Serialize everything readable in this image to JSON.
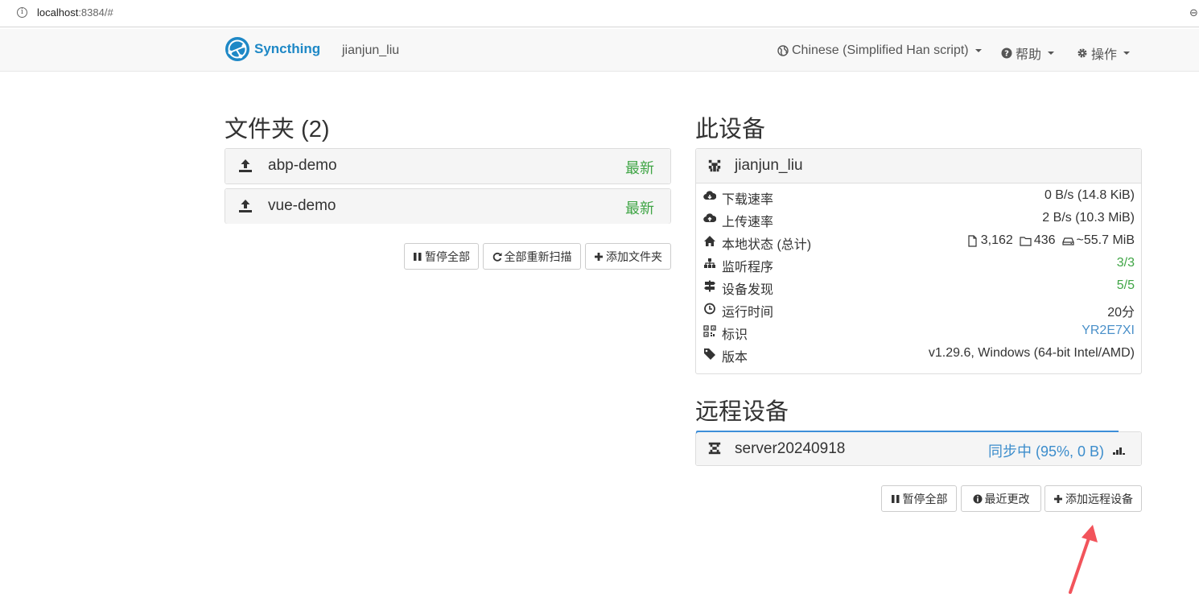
{
  "browser": {
    "url_host": "localhost",
    "url_rest": ":8384/#"
  },
  "navbar": {
    "brand": "Syncthing",
    "device_name": "jianjun_liu",
    "language": "Chinese (Simplified Han script)",
    "help": "帮助",
    "actions": "操作"
  },
  "folders": {
    "heading": "文件夹 (2)",
    "items": [
      {
        "name": "abp-demo",
        "status": "最新"
      },
      {
        "name": "vue-demo",
        "status": "最新"
      }
    ],
    "buttons": {
      "pause_all": "暂停全部",
      "rescan_all": "全部重新扫描",
      "add_folder": "添加文件夹"
    }
  },
  "this_device": {
    "heading": "此设备",
    "name": "jianjun_liu",
    "rows": [
      {
        "label": "下载速率",
        "value": "0 B/s (14.8 KiB)",
        "icon": "cloud-download-icon"
      },
      {
        "label": "上传速率",
        "value": "2 B/s (10.3 MiB)",
        "icon": "cloud-upload-icon"
      },
      {
        "label": "本地状态 (总计)",
        "files": "3,162",
        "dirs": "436",
        "size": "~55.7 MiB",
        "icon": "home-icon"
      },
      {
        "label": "监听程序",
        "value": "3/3",
        "icon": "sitemap-icon"
      },
      {
        "label": "设备发现",
        "value": "5/5",
        "icon": "signpost-icon"
      },
      {
        "label": "运行时间",
        "value": "20分",
        "icon": "clock-icon"
      },
      {
        "label": "标识",
        "value": "YR2E7XI",
        "icon": "qrcode-icon"
      },
      {
        "label": "版本",
        "value": "v1.29.6, Windows (64-bit Intel/AMD)",
        "icon": "tag-icon"
      }
    ],
    "colors": {
      "green": "#3fa545",
      "blue": "#4a90c9"
    }
  },
  "remote_devices": {
    "heading": "远程设备",
    "items": [
      {
        "name": "server20240918",
        "status": "同步中 (95%, 0 B)",
        "progress": 0.95
      }
    ],
    "buttons": {
      "pause_all": "暂停全部",
      "recent_changes": "最近更改",
      "add_remote": "添加远程设备"
    }
  }
}
